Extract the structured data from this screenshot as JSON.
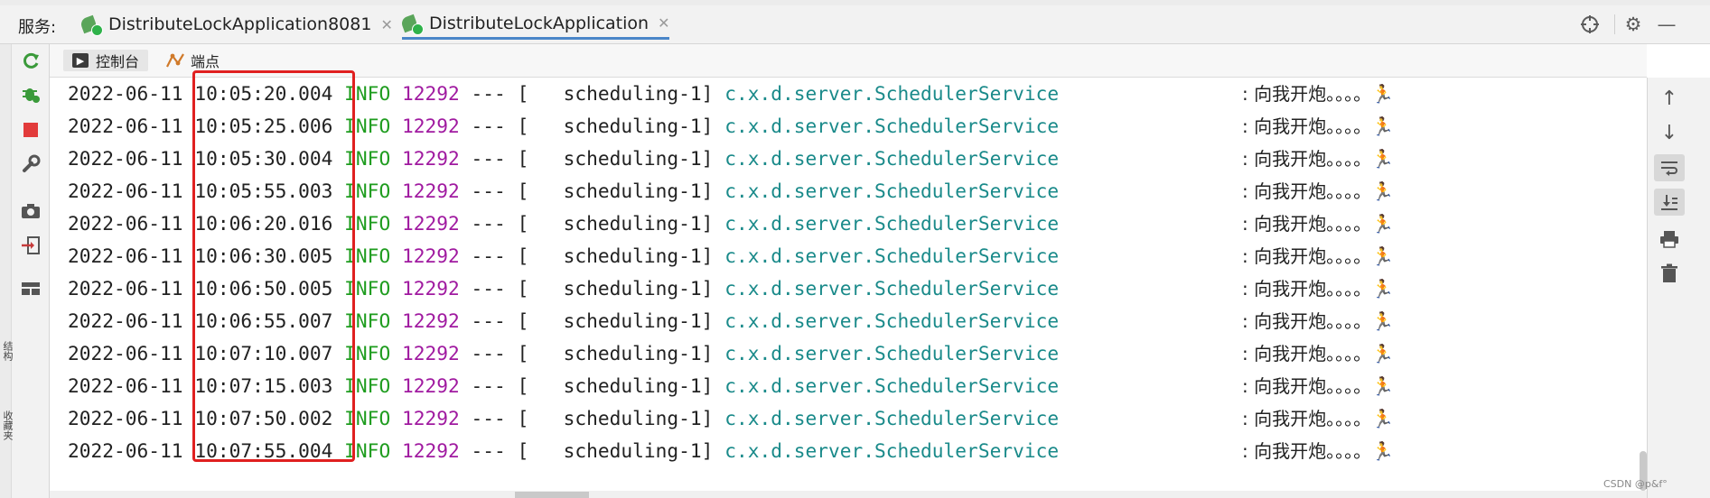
{
  "header": {
    "services_label": "服务:",
    "tabs": [
      {
        "label": "DistributeLockApplication8081",
        "active": false
      },
      {
        "label": "DistributeLockApplication",
        "active": true
      }
    ]
  },
  "side_vertical_text": [
    "结构",
    "收藏夹"
  ],
  "subtabs": [
    {
      "label": "控制台",
      "icon": "console-icon"
    },
    {
      "label": "端点",
      "icon": "endpoints-icon"
    }
  ],
  "log_lines": [
    {
      "date": "2022-06-11",
      "time": "10:05:20.004",
      "level": "INFO",
      "pid": "12292",
      "sep": "---",
      "thread": "[   scheduling-1]",
      "logger": "c.x.d.server.SchedulerService",
      "message": ": 向我开炮。。。。",
      "emoji": "🏃"
    },
    {
      "date": "2022-06-11",
      "time": "10:05:25.006",
      "level": "INFO",
      "pid": "12292",
      "sep": "---",
      "thread": "[   scheduling-1]",
      "logger": "c.x.d.server.SchedulerService",
      "message": ": 向我开炮。。。。",
      "emoji": "🏃"
    },
    {
      "date": "2022-06-11",
      "time": "10:05:30.004",
      "level": "INFO",
      "pid": "12292",
      "sep": "---",
      "thread": "[   scheduling-1]",
      "logger": "c.x.d.server.SchedulerService",
      "message": ": 向我开炮。。。。",
      "emoji": "🏃"
    },
    {
      "date": "2022-06-11",
      "time": "10:05:55.003",
      "level": "INFO",
      "pid": "12292",
      "sep": "---",
      "thread": "[   scheduling-1]",
      "logger": "c.x.d.server.SchedulerService",
      "message": ": 向我开炮。。。。",
      "emoji": "🏃"
    },
    {
      "date": "2022-06-11",
      "time": "10:06:20.016",
      "level": "INFO",
      "pid": "12292",
      "sep": "---",
      "thread": "[   scheduling-1]",
      "logger": "c.x.d.server.SchedulerService",
      "message": ": 向我开炮。。。。",
      "emoji": "🏃"
    },
    {
      "date": "2022-06-11",
      "time": "10:06:30.005",
      "level": "INFO",
      "pid": "12292",
      "sep": "---",
      "thread": "[   scheduling-1]",
      "logger": "c.x.d.server.SchedulerService",
      "message": ": 向我开炮。。。。",
      "emoji": "🏃"
    },
    {
      "date": "2022-06-11",
      "time": "10:06:50.005",
      "level": "INFO",
      "pid": "12292",
      "sep": "---",
      "thread": "[   scheduling-1]",
      "logger": "c.x.d.server.SchedulerService",
      "message": ": 向我开炮。。。。",
      "emoji": "🏃"
    },
    {
      "date": "2022-06-11",
      "time": "10:06:55.007",
      "level": "INFO",
      "pid": "12292",
      "sep": "---",
      "thread": "[   scheduling-1]",
      "logger": "c.x.d.server.SchedulerService",
      "message": ": 向我开炮。。。。",
      "emoji": "🏃"
    },
    {
      "date": "2022-06-11",
      "time": "10:07:10.007",
      "level": "INFO",
      "pid": "12292",
      "sep": "---",
      "thread": "[   scheduling-1]",
      "logger": "c.x.d.server.SchedulerService",
      "message": ": 向我开炮。。。。",
      "emoji": "🏃"
    },
    {
      "date": "2022-06-11",
      "time": "10:07:15.003",
      "level": "INFO",
      "pid": "12292",
      "sep": "---",
      "thread": "[   scheduling-1]",
      "logger": "c.x.d.server.SchedulerService",
      "message": ": 向我开炮。。。。",
      "emoji": "🏃"
    },
    {
      "date": "2022-06-11",
      "time": "10:07:50.002",
      "level": "INFO",
      "pid": "12292",
      "sep": "---",
      "thread": "[   scheduling-1]",
      "logger": "c.x.d.server.SchedulerService",
      "message": ": 向我开炮。。。。",
      "emoji": "🏃"
    },
    {
      "date": "2022-06-11",
      "time": "10:07:55.004",
      "level": "INFO",
      "pid": "12292",
      "sep": "---",
      "thread": "[   scheduling-1]",
      "logger": "c.x.d.server.SchedulerService",
      "message": ": 向我开炮。。。。",
      "emoji": "🏃"
    }
  ],
  "watermark": "CSDN @p&f°",
  "colors": {
    "level": "#1e9c1e",
    "pid": "#a01aa0",
    "logger": "#1a8a8a",
    "highlight": "#e02020",
    "tab_active_underline": "#4a86c8"
  }
}
